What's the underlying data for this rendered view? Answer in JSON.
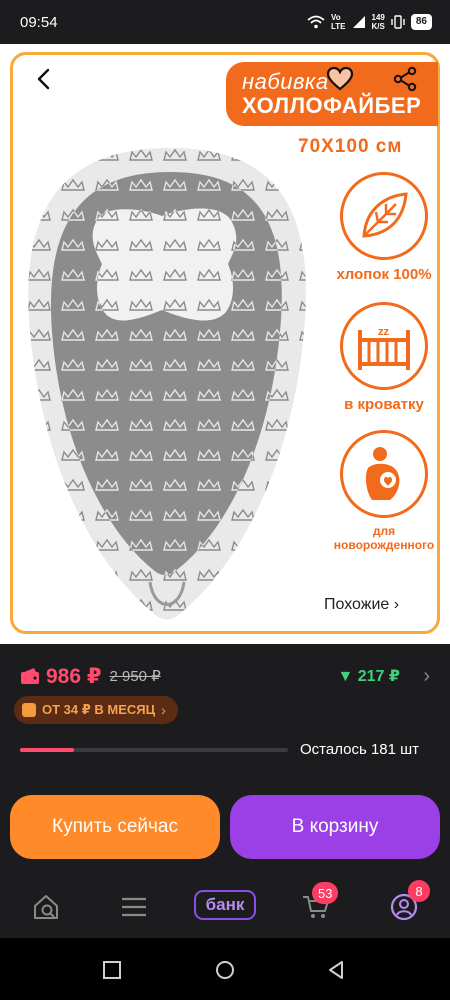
{
  "status_bar": {
    "time": "09:54",
    "net_top": "Vo",
    "net_bottom": "LTE",
    "speed_top": "149",
    "speed_bottom": "K/S",
    "battery": "86"
  },
  "product_image": {
    "promo_line1": "набивка",
    "promo_line2": "ХОЛЛОФАЙБЕР",
    "size": "70X100 см",
    "features": [
      {
        "label": "хлопок 100%",
        "icon": "leaf-icon"
      },
      {
        "label": "в кроватку",
        "icon": "crib-icon"
      },
      {
        "label": "для новорожденного",
        "icon": "mother-baby-icon"
      }
    ],
    "similar_link": "Похожие ›"
  },
  "price": {
    "current": "986 ₽",
    "old": "2 950 ₽",
    "bonus": "▼ 217 ₽",
    "installment": "ОТ 34 ₽ В МЕСЯЦ",
    "stock_text": "Осталось 181 шт",
    "stock_fraction": 0.2
  },
  "actions": {
    "buy_now": "Купить сейчас",
    "add_to_cart": "В корзину"
  },
  "bottom_nav": {
    "bank_label": "банк",
    "cart_badge": "53",
    "profile_badge": "8"
  },
  "colors": {
    "accent_orange": "#f26a1b",
    "price_pink": "#ff4b6e",
    "bonus_green": "#3dd17a",
    "cart_purple": "#9b3fe6",
    "buy_orange": "#ff8a2a"
  }
}
